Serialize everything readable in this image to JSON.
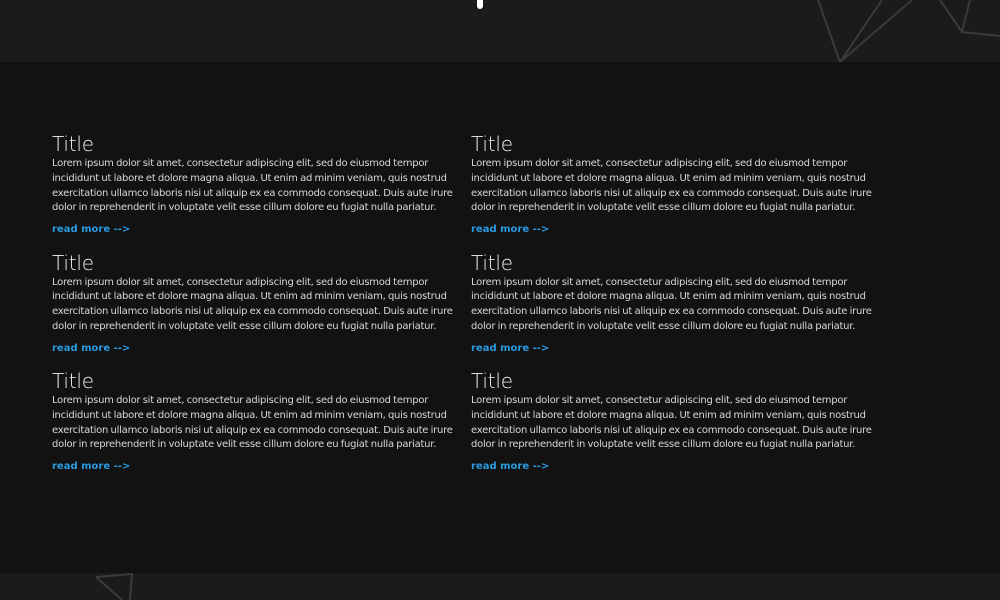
{
  "colors": {
    "page_bg": "#121212",
    "band_bg": "#1b1b1b",
    "title": "#f1f1f1",
    "body_text": "#d8d8d8",
    "link": "#2b9be0",
    "deco_lines": "#3a3a3a"
  },
  "icons": {
    "top_decoration": "geometric-line-art-icon",
    "bottom_decoration": "geometric-line-art-icon",
    "scroll_indicator": "scroll-tick-icon"
  },
  "cards": [
    {
      "title": "Title",
      "body": "Lorem ipsum dolor sit amet, consectetur adipiscing elit, sed do eiusmod tempor incididunt ut labore et dolore magna aliqua. Ut enim ad minim veniam, quis nostrud exercitation ullamco laboris nisi ut aliquip ex ea commodo consequat. Duis aute irure dolor in reprehenderit in voluptate velit esse cillum dolore eu fugiat nulla pariatur. Excepteur sint occaecat cupidatat non proident, sunt in",
      "link": "read more -->"
    },
    {
      "title": "Title",
      "body": "Lorem ipsum dolor sit amet, consectetur adipiscing elit, sed do eiusmod tempor incididunt ut labore et dolore magna aliqua. Ut enim ad minim veniam, quis nostrud exercitation ullamco laboris nisi ut aliquip ex ea commodo consequat. Duis aute irure dolor in reprehenderit in voluptate velit esse cillum dolore eu fugiat nulla pariatur. Excepteur sint occaecat cupidatat non proident, sunt in",
      "link": "read more -->"
    },
    {
      "title": "Title",
      "body": "Lorem ipsum dolor sit amet, consectetur adipiscing elit, sed do eiusmod tempor incididunt ut labore et dolore magna aliqua. Ut enim ad minim veniam, quis nostrud exercitation ullamco laboris nisi ut aliquip ex ea commodo consequat. Duis aute irure dolor in reprehenderit in voluptate velit esse cillum dolore eu fugiat nulla pariatur. Excepteur sint occaecat cupidatat non proident, sunt in",
      "link": "read more -->"
    },
    {
      "title": "Title",
      "body": "Lorem ipsum dolor sit amet, consectetur adipiscing elit, sed do eiusmod tempor incididunt ut labore et dolore magna aliqua. Ut enim ad minim veniam, quis nostrud exercitation ullamco laboris nisi ut aliquip ex ea commodo consequat. Duis aute irure dolor in reprehenderit in voluptate velit esse cillum dolore eu fugiat nulla pariatur. Excepteur sint occaecat cupidatat non proident, sunt in",
      "link": "read more -->"
    },
    {
      "title": "Title",
      "body": "Lorem ipsum dolor sit amet, consectetur adipiscing elit, sed do eiusmod tempor incididunt ut labore et dolore magna aliqua. Ut enim ad minim veniam, quis nostrud exercitation ullamco laboris nisi ut aliquip ex ea commodo consequat. Duis aute irure dolor in reprehenderit in voluptate velit esse cillum dolore eu fugiat nulla pariatur. Excepteur sint occaecat cupidatat non proident, sunt in",
      "link": "read more -->"
    },
    {
      "title": "Title",
      "body": "Lorem ipsum dolor sit amet, consectetur adipiscing elit, sed do eiusmod tempor incididunt ut labore et dolore magna aliqua. Ut enim ad minim veniam, quis nostrud exercitation ullamco laboris nisi ut aliquip ex ea commodo consequat. Duis aute irure dolor in reprehenderit in voluptate velit esse cillum dolore eu fugiat nulla pariatur. Excepteur sint occaecat cupidatat non proident, sunt in",
      "link": "read more -->"
    }
  ]
}
